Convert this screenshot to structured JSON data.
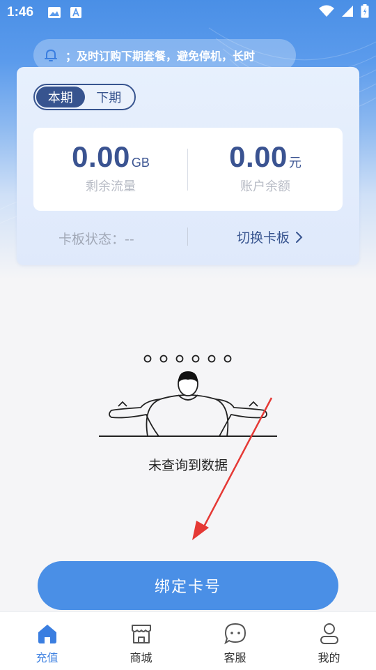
{
  "status_bar": {
    "time": "1:46"
  },
  "notice": {
    "text": "；及时订购下期套餐，避免停机，长时"
  },
  "period_toggle": {
    "current": "本期",
    "next": "下期"
  },
  "stats": {
    "data_remaining": {
      "value": "0.00",
      "unit": "GB",
      "label": "剩余流量"
    },
    "balance": {
      "value": "0.00",
      "unit": "元",
      "label": "账户余额"
    }
  },
  "card_footer": {
    "board_status": "卡板状态：--",
    "switch_board": "切换卡板"
  },
  "empty_state": {
    "text": "未查询到数据"
  },
  "bind_button": {
    "label": "绑定卡号"
  },
  "bottom_nav": [
    {
      "label": "充值",
      "icon": "home-icon",
      "active": true
    },
    {
      "label": "商城",
      "icon": "store-icon",
      "active": false
    },
    {
      "label": "客服",
      "icon": "chat-icon",
      "active": false
    },
    {
      "label": "我的",
      "icon": "user-icon",
      "active": false
    }
  ],
  "colors": {
    "accent": "#4a8fe6",
    "dark_blue": "#37548f",
    "nav_active": "#3a7ee0",
    "annotation_arrow": "#e53935"
  }
}
